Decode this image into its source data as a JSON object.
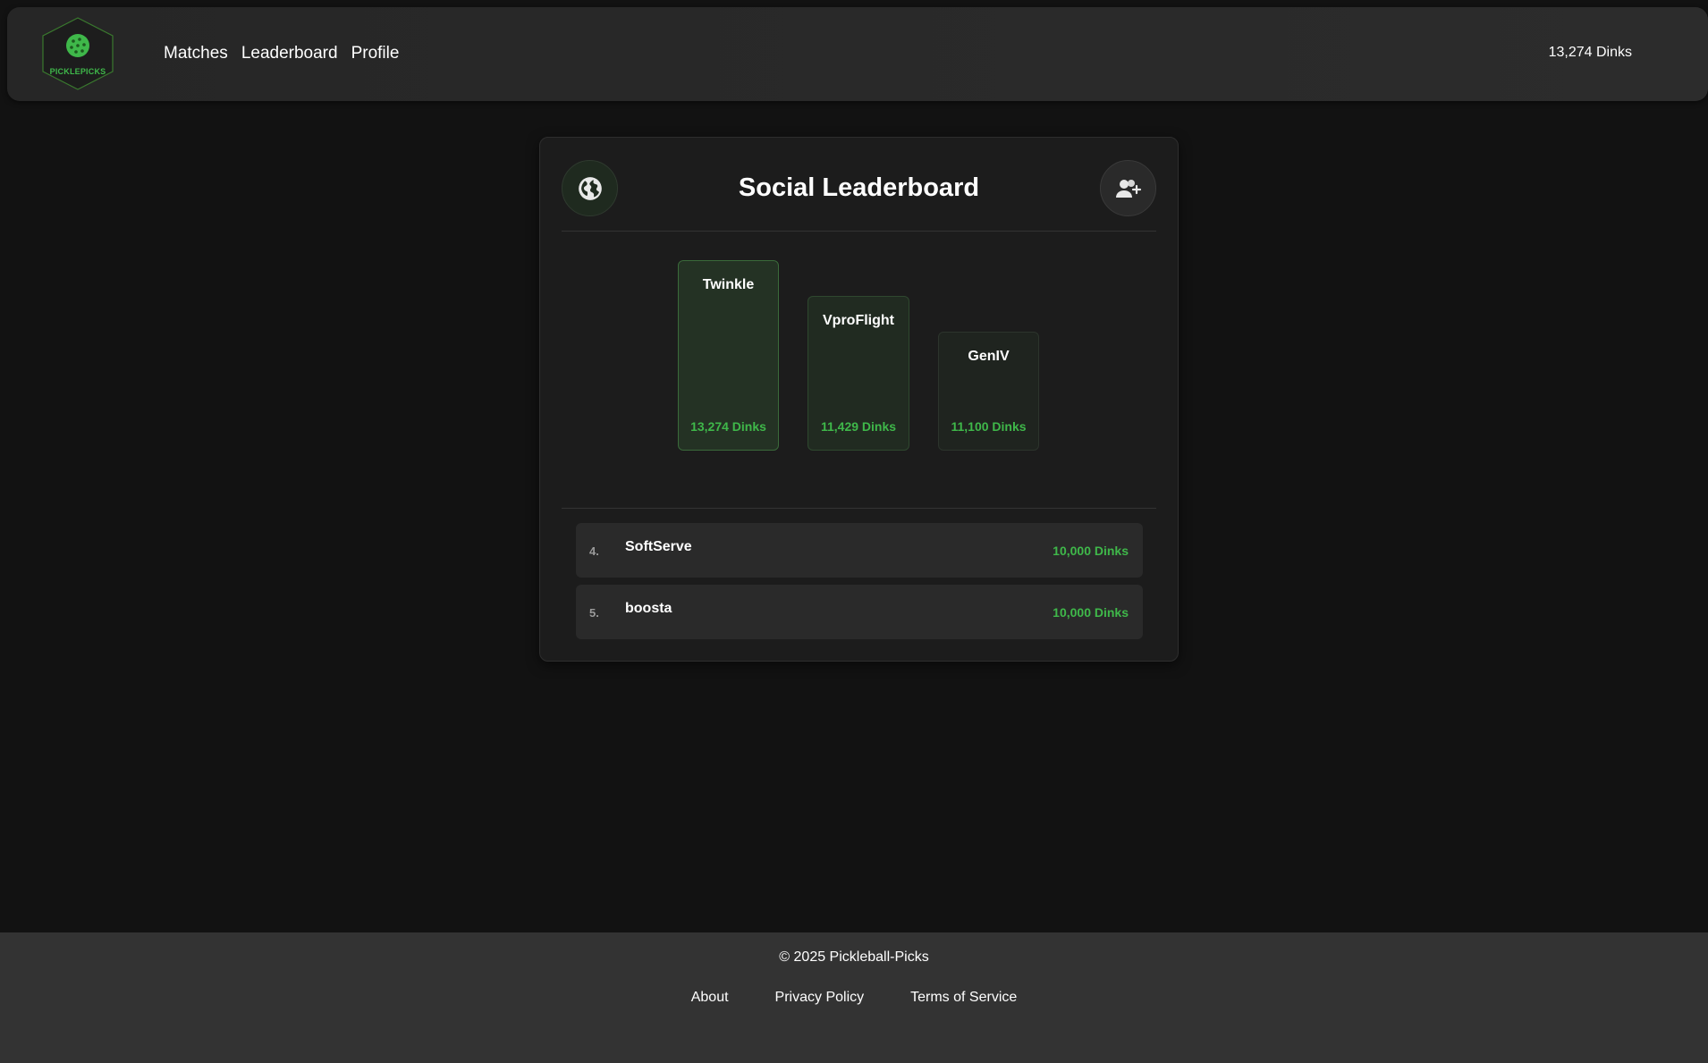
{
  "header": {
    "logo_text": "PICKLEPICKS",
    "nav": [
      {
        "label": "Matches"
      },
      {
        "label": "Leaderboard"
      },
      {
        "label": "Profile"
      }
    ],
    "balance": "13,274 Dinks"
  },
  "leaderboard": {
    "title": "Social Leaderboard",
    "left_button_icon": "globe-icon",
    "right_button_icon": "add-friend-icon",
    "podium": [
      {
        "name": "Twinkle",
        "score": "13,274 Dinks"
      },
      {
        "name": "VproFlight",
        "score": "11,429 Dinks"
      },
      {
        "name": "GenIV",
        "score": "11,100 Dinks"
      }
    ],
    "rows": [
      {
        "rank": "4.",
        "name": "SoftServe",
        "score": "10,000 Dinks"
      },
      {
        "rank": "5.",
        "name": "boosta",
        "score": "10,000 Dinks"
      }
    ]
  },
  "footer": {
    "copyright": "© 2025 Pickleball-Picks",
    "links": [
      {
        "label": "About"
      },
      {
        "label": "Privacy Policy"
      },
      {
        "label": "Terms of Service"
      }
    ]
  },
  "colors": {
    "background": "#121212",
    "accent": "#3fb84a",
    "card": "#1c1c1c",
    "footer": "#333333"
  }
}
